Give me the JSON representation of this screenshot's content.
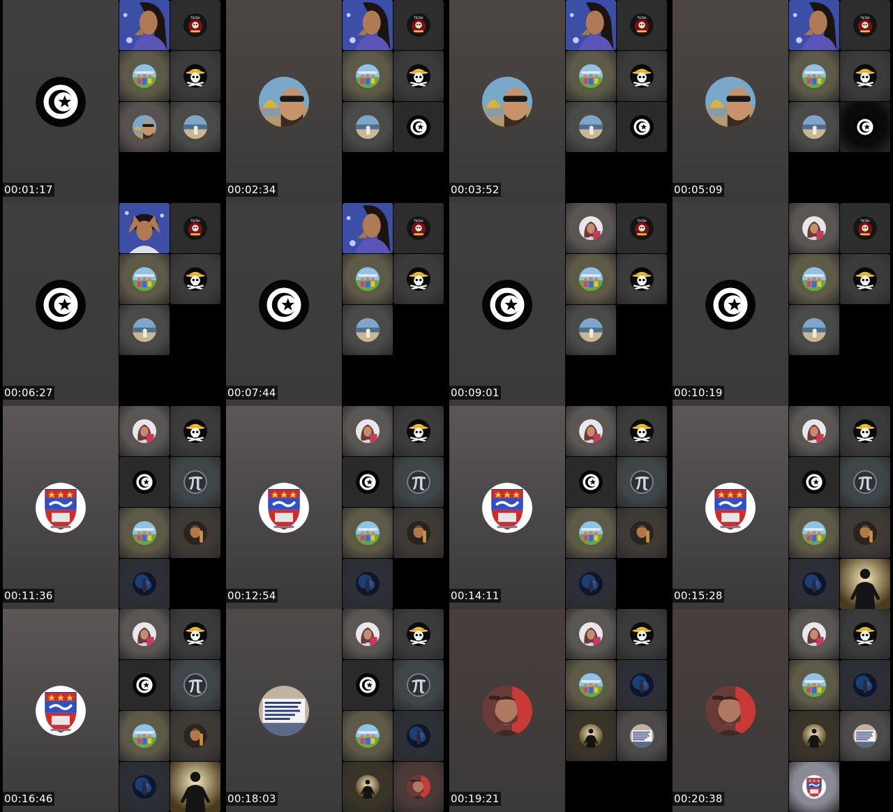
{
  "thumbnails": [
    {
      "timestamp": "00:01:17",
      "main": {
        "avatar": "tunisia-flag-icon",
        "bg": "#3f3f3f"
      },
      "tiles": [
        {
          "avatar": "woman-purple",
          "bg": "#3a4ea0",
          "full": true
        },
        {
          "avatar": "tiktok-jack-badge",
          "bg": "#2e2e2e"
        },
        {
          "avatar": "family-photo",
          "bg": "#5e5a48"
        },
        {
          "avatar": "straw-hat-jolly-roger-icon",
          "bg": "#3b3b3b"
        },
        {
          "avatar": "man-sunglasses-dome",
          "bg": "#575250"
        },
        {
          "avatar": "beach-person",
          "bg": "#4a4a48"
        }
      ]
    },
    {
      "timestamp": "00:02:34",
      "main": {
        "avatar": "man-sunglasses-dome",
        "bg": "#4c4643"
      },
      "tiles": [
        {
          "avatar": "woman-purple",
          "bg": "#3a4ea0",
          "full": true
        },
        {
          "avatar": "tiktok-jack-badge",
          "bg": "#2e2e2e"
        },
        {
          "avatar": "family-photo",
          "bg": "#5e5a48"
        },
        {
          "avatar": "straw-hat-jolly-roger-icon",
          "bg": "#3b3b3b"
        },
        {
          "avatar": "beach-person",
          "bg": "#4a4a48"
        },
        {
          "avatar": "tunisia-flag-icon",
          "bg": "#2a2a2a"
        }
      ]
    },
    {
      "timestamp": "00:03:52",
      "main": {
        "avatar": "man-sunglasses-dome",
        "bg": "#4c4643"
      },
      "tiles": [
        {
          "avatar": "woman-purple",
          "bg": "#3a4ea0",
          "full": true
        },
        {
          "avatar": "tiktok-jack-badge",
          "bg": "#2e2e2e"
        },
        {
          "avatar": "family-photo",
          "bg": "#5e5a48"
        },
        {
          "avatar": "straw-hat-jolly-roger-icon",
          "bg": "#3b3b3b"
        },
        {
          "avatar": "beach-person",
          "bg": "#4a4a48"
        },
        {
          "avatar": "tunisia-flag-icon",
          "bg": "#2a2a2a"
        }
      ]
    },
    {
      "timestamp": "00:05:09",
      "main": {
        "avatar": "man-sunglasses-dome",
        "bg": "#4c4643"
      },
      "tiles": [
        {
          "avatar": "woman-purple",
          "bg": "#3a4ea0",
          "full": true
        },
        {
          "avatar": "tiktok-jack-badge",
          "bg": "#2e2e2e"
        },
        {
          "avatar": "family-photo",
          "bg": "#5e5a48"
        },
        {
          "avatar": "straw-hat-jolly-roger-icon",
          "bg": "#3b3b3b"
        },
        {
          "avatar": "beach-person",
          "bg": "#4a4a48"
        },
        {
          "avatar": "tunisia-flag-icon",
          "bg": "#0a0a0a"
        }
      ]
    },
    {
      "timestamp": "00:06:27",
      "main": {
        "avatar": "tunisia-flag-icon",
        "bg": "#3f3f3f"
      },
      "tiles": [
        {
          "avatar": "woman-hands-head",
          "bg": "#3a4ea0",
          "full": true
        },
        {
          "avatar": "tiktok-jack-badge",
          "bg": "#2e2e2e"
        },
        {
          "avatar": "family-photo",
          "bg": "#5e5a48"
        },
        {
          "avatar": "straw-hat-jolly-roger-icon",
          "bg": "#3b3b3b"
        },
        {
          "avatar": "beach-person",
          "bg": "#4a4a48"
        }
      ]
    },
    {
      "timestamp": "00:07:44",
      "main": {
        "avatar": "tunisia-flag-icon",
        "bg": "#3f3f3f"
      },
      "tiles": [
        {
          "avatar": "woman-purple",
          "bg": "#3a4ea0",
          "full": true
        },
        {
          "avatar": "tiktok-jack-badge",
          "bg": "#2e2e2e"
        },
        {
          "avatar": "family-photo",
          "bg": "#5e5a48"
        },
        {
          "avatar": "straw-hat-jolly-roger-icon",
          "bg": "#3b3b3b"
        },
        {
          "avatar": "beach-person",
          "bg": "#4a4a48"
        }
      ]
    },
    {
      "timestamp": "00:09:01",
      "main": {
        "avatar": "tunisia-flag-icon",
        "bg": "#3f3f3f"
      },
      "tiles": [
        {
          "avatar": "woman-headscarf",
          "bg": "#5a5654"
        },
        {
          "avatar": "tiktok-jack-badge",
          "bg": "#2e2e2e"
        },
        {
          "avatar": "family-photo",
          "bg": "#5e5a48"
        },
        {
          "avatar": "straw-hat-jolly-roger-icon",
          "bg": "#3b3b3b"
        },
        {
          "avatar": "beach-person",
          "bg": "#4a4a48"
        }
      ]
    },
    {
      "timestamp": "00:10:19",
      "main": {
        "avatar": "tunisia-flag-icon",
        "bg": "#3f3f3f"
      },
      "tiles": [
        {
          "avatar": "woman-headscarf",
          "bg": "#5a5654"
        },
        {
          "avatar": "tiktok-jack-badge",
          "bg": "#2e2e2e"
        },
        {
          "avatar": "family-photo",
          "bg": "#5e5a48"
        },
        {
          "avatar": "straw-hat-jolly-roger-icon",
          "bg": "#3b3b3b"
        },
        {
          "avatar": "beach-person",
          "bg": "#4a4a48"
        }
      ]
    },
    {
      "timestamp": "00:11:36",
      "main": {
        "avatar": "coat-of-arms-badge",
        "bg": "#5c5657"
      },
      "tiles": [
        {
          "avatar": "woman-headscarf",
          "bg": "#5a5654"
        },
        {
          "avatar": "straw-hat-jolly-roger-icon",
          "bg": "#3b3b3b"
        },
        {
          "avatar": "tunisia-flag-icon",
          "bg": "#2a2a2a"
        },
        {
          "avatar": "pi-symbol-icon",
          "bg": "#404548"
        },
        {
          "avatar": "family-photo",
          "bg": "#5e5a48"
        },
        {
          "avatar": "bearded-man",
          "bg": "#3e3a36"
        },
        {
          "avatar": "blue-space-figure",
          "bg": "#2c2f36"
        }
      ]
    },
    {
      "timestamp": "00:12:54",
      "main": {
        "avatar": "coat-of-arms-badge",
        "bg": "#5c5657"
      },
      "tiles": [
        {
          "avatar": "woman-headscarf",
          "bg": "#5a5654"
        },
        {
          "avatar": "straw-hat-jolly-roger-icon",
          "bg": "#3b3b3b"
        },
        {
          "avatar": "tunisia-flag-icon",
          "bg": "#2a2a2a"
        },
        {
          "avatar": "pi-symbol-icon",
          "bg": "#404548"
        },
        {
          "avatar": "family-photo",
          "bg": "#5e5a48"
        },
        {
          "avatar": "bearded-man",
          "bg": "#3e3a36"
        },
        {
          "avatar": "blue-space-figure",
          "bg": "#2c2f36"
        }
      ]
    },
    {
      "timestamp": "00:14:11",
      "main": {
        "avatar": "coat-of-arms-badge",
        "bg": "#5c5657"
      },
      "tiles": [
        {
          "avatar": "woman-headscarf",
          "bg": "#5a5654"
        },
        {
          "avatar": "straw-hat-jolly-roger-icon",
          "bg": "#3b3b3b"
        },
        {
          "avatar": "tunisia-flag-icon",
          "bg": "#2a2a2a"
        },
        {
          "avatar": "pi-symbol-icon",
          "bg": "#404548"
        },
        {
          "avatar": "family-photo",
          "bg": "#5e5a48"
        },
        {
          "avatar": "bearded-man",
          "bg": "#3e3a36"
        },
        {
          "avatar": "blue-space-figure",
          "bg": "#2c2f36"
        }
      ]
    },
    {
      "timestamp": "00:15:28",
      "main": {
        "avatar": "coat-of-arms-badge",
        "bg": "#5c5657"
      },
      "tiles": [
        {
          "avatar": "woman-headscarf",
          "bg": "#5a5654"
        },
        {
          "avatar": "straw-hat-jolly-roger-icon",
          "bg": "#3b3b3b"
        },
        {
          "avatar": "tunisia-flag-icon",
          "bg": "#2a2a2a"
        },
        {
          "avatar": "pi-symbol-icon",
          "bg": "#404548"
        },
        {
          "avatar": "family-photo",
          "bg": "#5e5a48"
        },
        {
          "avatar": "bearded-man",
          "bg": "#3e3a36"
        },
        {
          "avatar": "blue-space-figure",
          "bg": "#2c2f36"
        },
        {
          "avatar": "gladiator-silhouette",
          "bg": "#4a4030",
          "full": true
        }
      ]
    },
    {
      "timestamp": "00:16:46",
      "main": {
        "avatar": "coat-of-arms-badge",
        "bg": "#5c5657"
      },
      "tiles": [
        {
          "avatar": "woman-headscarf",
          "bg": "#5a5654"
        },
        {
          "avatar": "straw-hat-jolly-roger-icon",
          "bg": "#3b3b3b"
        },
        {
          "avatar": "tunisia-flag-icon",
          "bg": "#2a2a2a"
        },
        {
          "avatar": "pi-symbol-icon",
          "bg": "#404548"
        },
        {
          "avatar": "family-photo",
          "bg": "#5e5a48"
        },
        {
          "avatar": "bearded-man",
          "bg": "#3e3a36"
        },
        {
          "avatar": "blue-space-figure",
          "bg": "#2c2f36"
        },
        {
          "avatar": "gladiator-silhouette",
          "bg": "#4a4030",
          "full": true
        }
      ]
    },
    {
      "timestamp": "00:18:03",
      "main": {
        "avatar": "news-text-card",
        "bg": "#4e4a4a"
      },
      "tiles": [
        {
          "avatar": "woman-headscarf",
          "bg": "#5a5654"
        },
        {
          "avatar": "straw-hat-jolly-roger-icon",
          "bg": "#3b3b3b"
        },
        {
          "avatar": "tunisia-flag-icon",
          "bg": "#2a2a2a"
        },
        {
          "avatar": "pi-symbol-icon",
          "bg": "#404548"
        },
        {
          "avatar": "family-photo",
          "bg": "#5e5a48"
        },
        {
          "avatar": "blue-space-figure",
          "bg": "#2c2f36"
        },
        {
          "avatar": "gladiator-silhouette",
          "bg": "#3a3428"
        },
        {
          "avatar": "man-red-backdrop",
          "bg": "#4a3a38"
        }
      ]
    },
    {
      "timestamp": "00:19:21",
      "main": {
        "avatar": "man-red-backdrop",
        "bg": "#4a3e3c"
      },
      "tiles": [
        {
          "avatar": "woman-headscarf",
          "bg": "#5a5654"
        },
        {
          "avatar": "straw-hat-jolly-roger-icon",
          "bg": "#3b3b3b"
        },
        {
          "avatar": "family-photo",
          "bg": "#5e5a48"
        },
        {
          "avatar": "blue-space-figure",
          "bg": "#2c2f36"
        },
        {
          "avatar": "gladiator-silhouette",
          "bg": "#3a3428"
        },
        {
          "avatar": "news-text-card",
          "bg": "#4e4a4a"
        }
      ]
    },
    {
      "timestamp": "00:20:38",
      "main": {
        "avatar": "man-red-backdrop",
        "bg": "#4a3e3c"
      },
      "tiles": [
        {
          "avatar": "woman-headscarf",
          "bg": "#5a5654"
        },
        {
          "avatar": "straw-hat-jolly-roger-icon",
          "bg": "#3b3b3b"
        },
        {
          "avatar": "family-photo",
          "bg": "#5e5a48"
        },
        {
          "avatar": "blue-space-figure",
          "bg": "#2c2f36"
        },
        {
          "avatar": "gladiator-silhouette",
          "bg": "#3a3428"
        },
        {
          "avatar": "news-text-card",
          "bg": "#4e4a4a"
        },
        {
          "avatar": "coat-of-arms-badge",
          "bg": "#8a8a96"
        }
      ]
    }
  ]
}
